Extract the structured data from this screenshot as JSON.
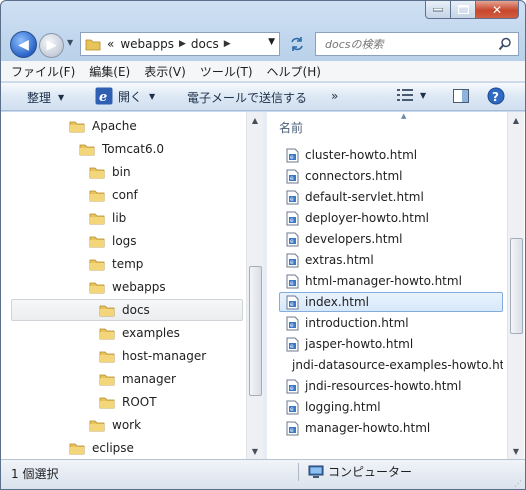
{
  "address": {
    "overflow": "«",
    "crumbs": [
      "webapps",
      "docs"
    ]
  },
  "search": {
    "placeholder": "docsの検索"
  },
  "menu": [
    "ファイル(F)",
    "編集(E)",
    "表示(V)",
    "ツール(T)",
    "ヘルプ(H)"
  ],
  "toolbar": {
    "organize": "整理",
    "open": "開く",
    "email": "電子メールで送信する"
  },
  "tree": {
    "items": [
      {
        "label": "Apache"
      },
      {
        "label": "Tomcat6.0"
      },
      {
        "label": "bin"
      },
      {
        "label": "conf"
      },
      {
        "label": "lib"
      },
      {
        "label": "logs"
      },
      {
        "label": "temp"
      },
      {
        "label": "webapps"
      },
      {
        "label": "docs",
        "selected": true
      },
      {
        "label": "examples"
      },
      {
        "label": "host-manager"
      },
      {
        "label": "manager"
      },
      {
        "label": "ROOT"
      },
      {
        "label": "work"
      },
      {
        "label": "eclipse"
      }
    ]
  },
  "files": {
    "column": "名前",
    "items": [
      {
        "label": "cluster-howto.html"
      },
      {
        "label": "connectors.html"
      },
      {
        "label": "default-servlet.html"
      },
      {
        "label": "deployer-howto.html"
      },
      {
        "label": "developers.html"
      },
      {
        "label": "extras.html"
      },
      {
        "label": "html-manager-howto.html"
      },
      {
        "label": "index.html",
        "selected": true
      },
      {
        "label": "introduction.html"
      },
      {
        "label": "jasper-howto.html"
      },
      {
        "label": "jndi-datasource-examples-howto.html"
      },
      {
        "label": "jndi-resources-howto.html"
      },
      {
        "label": "logging.html"
      },
      {
        "label": "manager-howto.html"
      }
    ]
  },
  "status": {
    "selection": "1 個選択",
    "location": "コンピューター"
  },
  "colors": {
    "selection_border": "#84acdd",
    "folder": "#e8c35a",
    "accent": "#2a63c7"
  }
}
